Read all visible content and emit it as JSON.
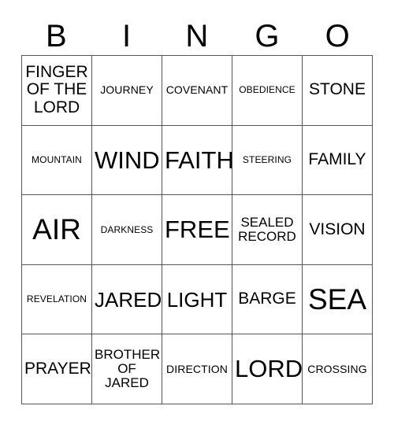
{
  "card": {
    "title_letters": [
      "B",
      "I",
      "N",
      "G",
      "O"
    ],
    "columns": 5,
    "rows": 5,
    "free_space": "FREE",
    "colors": {
      "background": "#ffffff",
      "text": "#000000",
      "grid_line": "#555555"
    },
    "cells": [
      {
        "text": "FINGER\nOF THE\nLORD",
        "size": "s-lg"
      },
      {
        "text": "JOURNEY",
        "size": "s-sm"
      },
      {
        "text": "COVENANT",
        "size": "s-sm"
      },
      {
        "text": "OBEDIENCE",
        "size": "s-xs"
      },
      {
        "text": "STONE",
        "size": "s-lg"
      },
      {
        "text": "MOUNTAIN",
        "size": "s-xs"
      },
      {
        "text": "WIND",
        "size": "s-xxl"
      },
      {
        "text": "FAITH",
        "size": "s-xxl"
      },
      {
        "text": "STEERING",
        "size": "s-xs"
      },
      {
        "text": "FAMILY",
        "size": "s-lg"
      },
      {
        "text": "AIR",
        "size": "s-3xl"
      },
      {
        "text": "DARKNESS",
        "size": "s-xs"
      },
      {
        "text": "FREE",
        "size": "s-xxl"
      },
      {
        "text": "SEALED\nRECORD",
        "size": "s-md"
      },
      {
        "text": "VISION",
        "size": "s-lg"
      },
      {
        "text": "REVELATION",
        "size": "s-xs"
      },
      {
        "text": "JARED",
        "size": "s-xl"
      },
      {
        "text": "LIGHT",
        "size": "s-xl"
      },
      {
        "text": "BARGE",
        "size": "s-lg"
      },
      {
        "text": "SEA",
        "size": "s-3xl"
      },
      {
        "text": "PRAYER",
        "size": "s-lg"
      },
      {
        "text": "BROTHER\nOF JARED",
        "size": "s-md"
      },
      {
        "text": "DIRECTION",
        "size": "s-sm"
      },
      {
        "text": "LORD",
        "size": "s-xxl"
      },
      {
        "text": "CROSSING",
        "size": "s-sm"
      }
    ]
  }
}
